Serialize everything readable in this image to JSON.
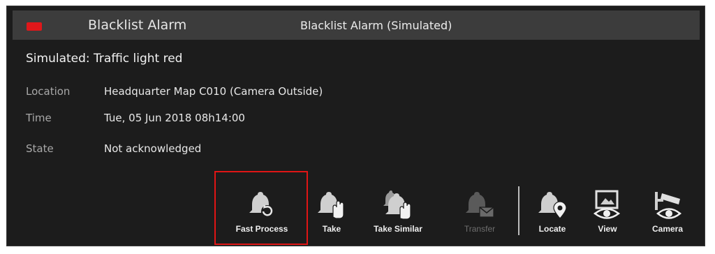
{
  "window": {
    "title": "Blacklist Alarm",
    "subtitle": "Blacklist Alarm (Simulated)",
    "alarm_color": "#e0171a"
  },
  "alarm": {
    "headline": "Simulated: Traffic light red",
    "fields": [
      {
        "label": "Location",
        "value": "Headquarter Map C010 (Camera Outside)"
      },
      {
        "label": "Time",
        "value": "Tue, 05 Jun 2018  08h14:00"
      },
      {
        "label": "State",
        "value": "Not acknowledged"
      }
    ]
  },
  "toolbar": {
    "buttons": [
      {
        "label": "Fast Process",
        "icon": "bell-refresh-icon",
        "enabled": true,
        "highlighted": true
      },
      {
        "label": "Take",
        "icon": "bell-hand-icon",
        "enabled": true
      },
      {
        "label": "Take Similar",
        "icon": "multi-bell-hand-icon",
        "enabled": true
      },
      {
        "label": "Transfer",
        "icon": "bell-envelope-icon",
        "enabled": false
      },
      {
        "label": "Locate",
        "icon": "bell-pin-icon",
        "enabled": true
      },
      {
        "label": "View",
        "icon": "monitor-eye-icon",
        "enabled": true
      },
      {
        "label": "Camera",
        "icon": "cctv-camera-icon",
        "enabled": true
      }
    ],
    "highlight_color": "#e01515"
  }
}
